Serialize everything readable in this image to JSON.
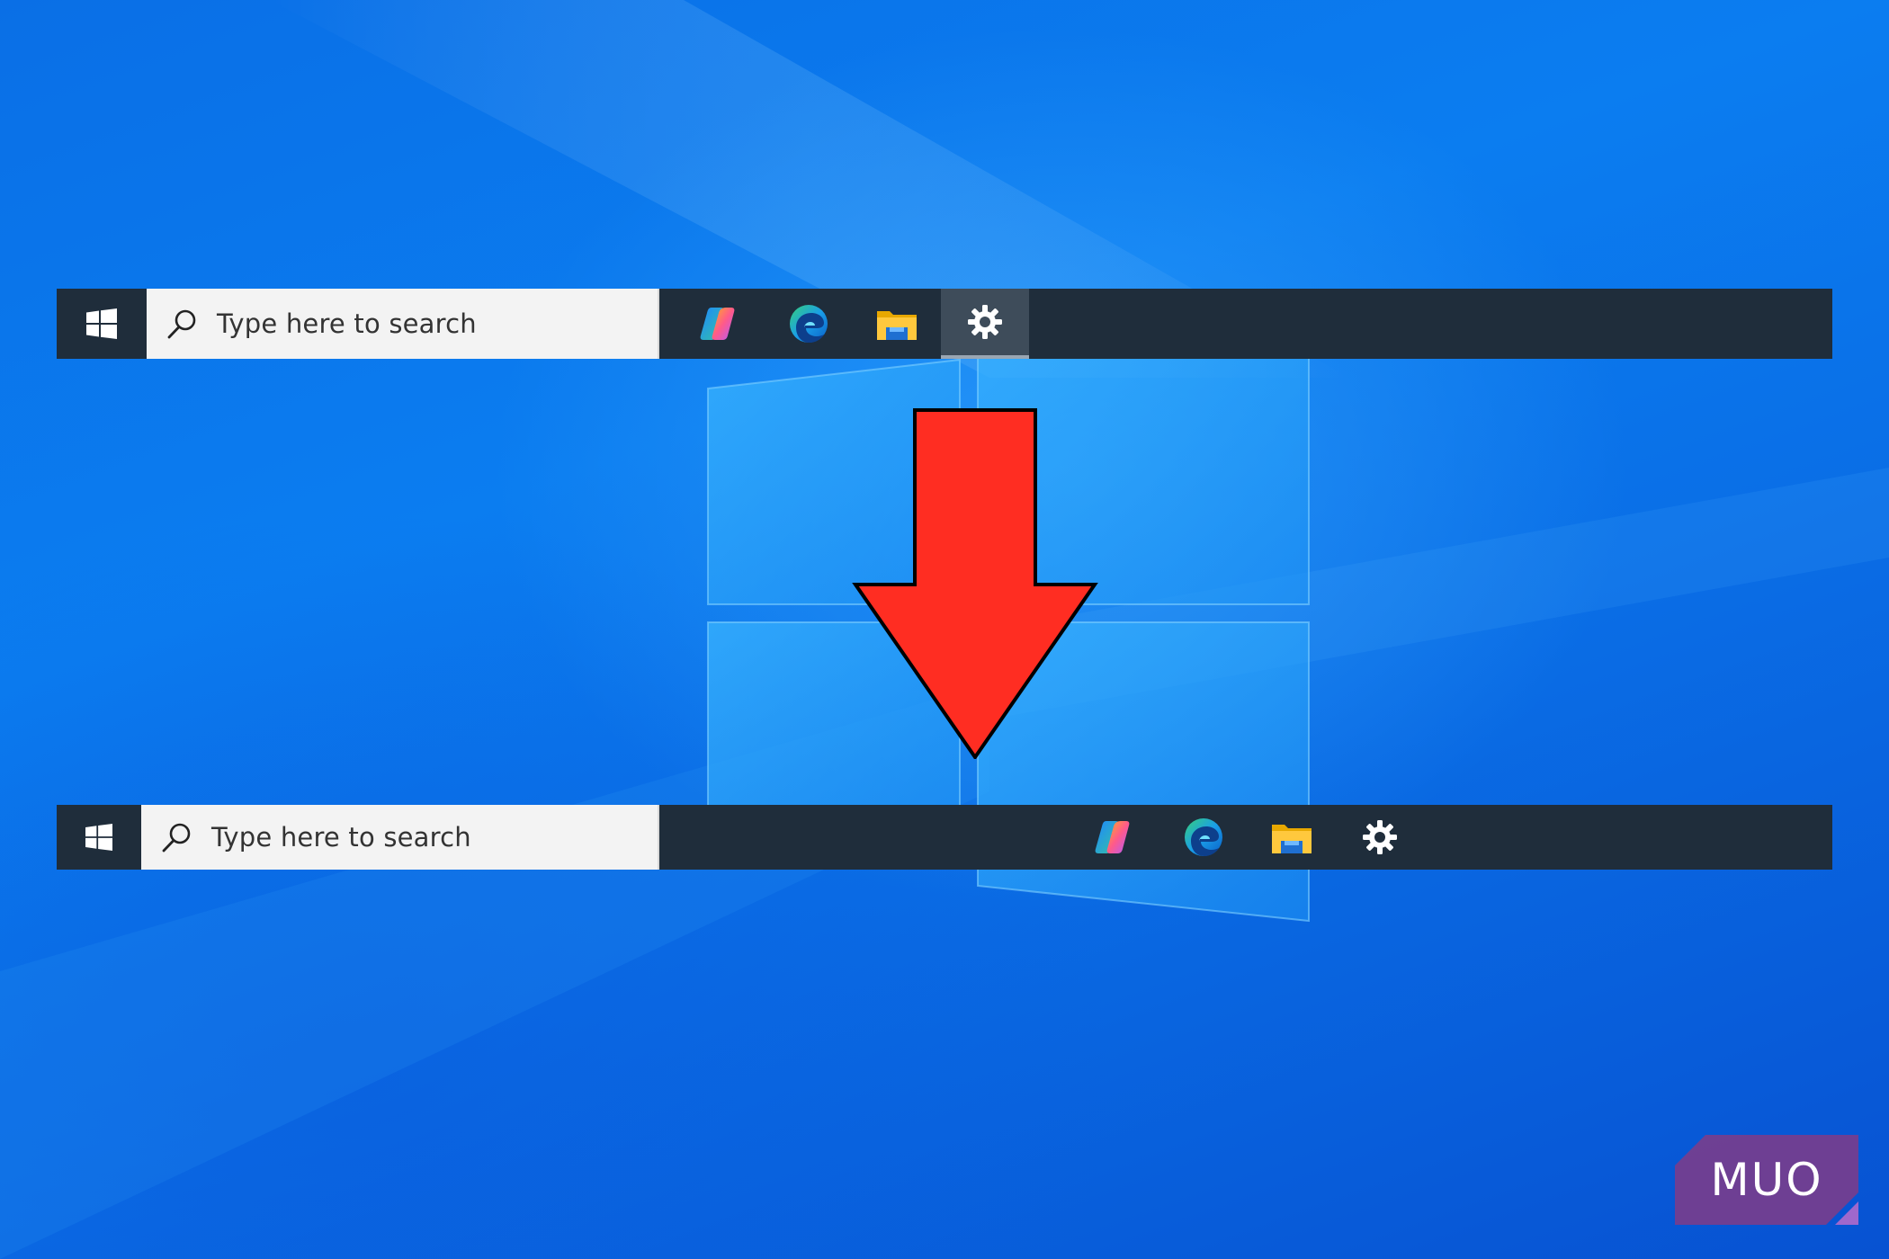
{
  "taskbar_top": {
    "search_placeholder": "Type here to search",
    "apps": [
      {
        "name": "Copilot",
        "icon": "copilot-icon"
      },
      {
        "name": "Microsoft Edge",
        "icon": "edge-icon"
      },
      {
        "name": "File Explorer",
        "icon": "file-explorer-icon"
      },
      {
        "name": "Settings",
        "icon": "settings-icon",
        "active": true
      }
    ]
  },
  "taskbar_bottom": {
    "search_placeholder": "Type here to search",
    "apps": [
      {
        "name": "Copilot",
        "icon": "copilot-icon"
      },
      {
        "name": "Microsoft Edge",
        "icon": "edge-icon"
      },
      {
        "name": "File Explorer",
        "icon": "file-explorer-icon"
      },
      {
        "name": "Settings",
        "icon": "settings-icon"
      }
    ]
  },
  "watermark": {
    "text": "MUO"
  },
  "colors": {
    "taskbar": "#1f2d3b",
    "search_box": "#f3f3f3",
    "arrow": "#ff2d22",
    "desktop_blue": "#0a6fe6",
    "watermark": "#7a3d8c"
  }
}
